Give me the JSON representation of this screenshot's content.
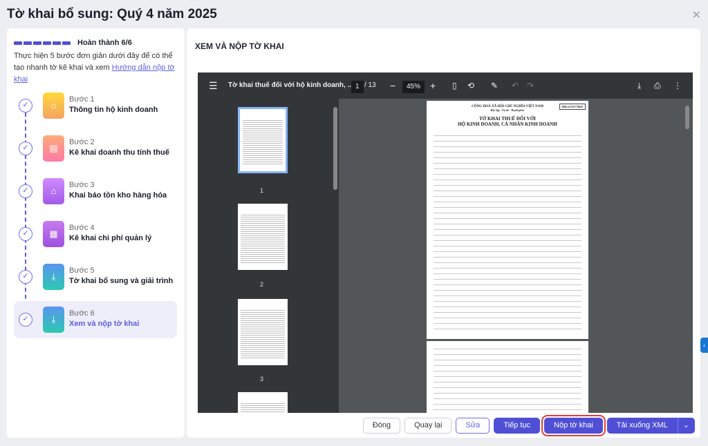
{
  "title": "Tờ khai bổ sung: Quý 4 năm 2025",
  "progress": {
    "label": "Hoàn thành 6/6",
    "completed": 6,
    "total": 6
  },
  "description": "Thực hiện 5 bước đơn giản dưới đây để có thể tạo nhanh tờ kê khai và xem ",
  "guide_link": "Hướng dẫn nộp tờ khai",
  "steps": [
    {
      "num": "Bước 1",
      "label": "Thông tin hộ kinh doanh",
      "icon": "store-icon"
    },
    {
      "num": "Bước 2",
      "label": "Kê khai doanh thu tính thuế",
      "icon": "document-icon"
    },
    {
      "num": "Bước 3",
      "label": "Khai báo tồn kho hàng hóa",
      "icon": "warehouse-icon"
    },
    {
      "num": "Bước 4",
      "label": "Kê khai chi phí quản lý",
      "icon": "clipboard-icon"
    },
    {
      "num": "Bước 5",
      "label": "Tờ khai bổ sung và giải trình",
      "icon": "file-download-icon"
    },
    {
      "num": "Bước 6",
      "label": "Xem và nộp tờ khai",
      "icon": "file-download-icon"
    }
  ],
  "section_title": "XEM VÀ NỘP TỜ KHAI",
  "viewer": {
    "doc_title": "Tờ khai thuế đối với hộ kinh doanh, ...",
    "page": "1",
    "pages": "/ 13",
    "zoom": "45%",
    "thumbs": [
      "1",
      "2",
      "3"
    ],
    "page_header": {
      "line1": "CỘNG HOÀ XÃ HỘI CHỦ NGHĨA VIỆT NAM",
      "line2": "Độc lập - Tự do - Hạnh phúc",
      "title1": "TỜ KHAI THUẾ ĐỐI VỚI",
      "title2": "HỘ KINH DOANH, CÁ NHÂN KINH DOANH",
      "form": "Mẫu số 01/CNKD"
    }
  },
  "buttons": {
    "close": "Đóng",
    "back": "Quay lại",
    "edit": "Sửa",
    "continue": "Tiếp tục",
    "submit": "Nộp tờ khai",
    "download": "Tải xuống XML"
  }
}
